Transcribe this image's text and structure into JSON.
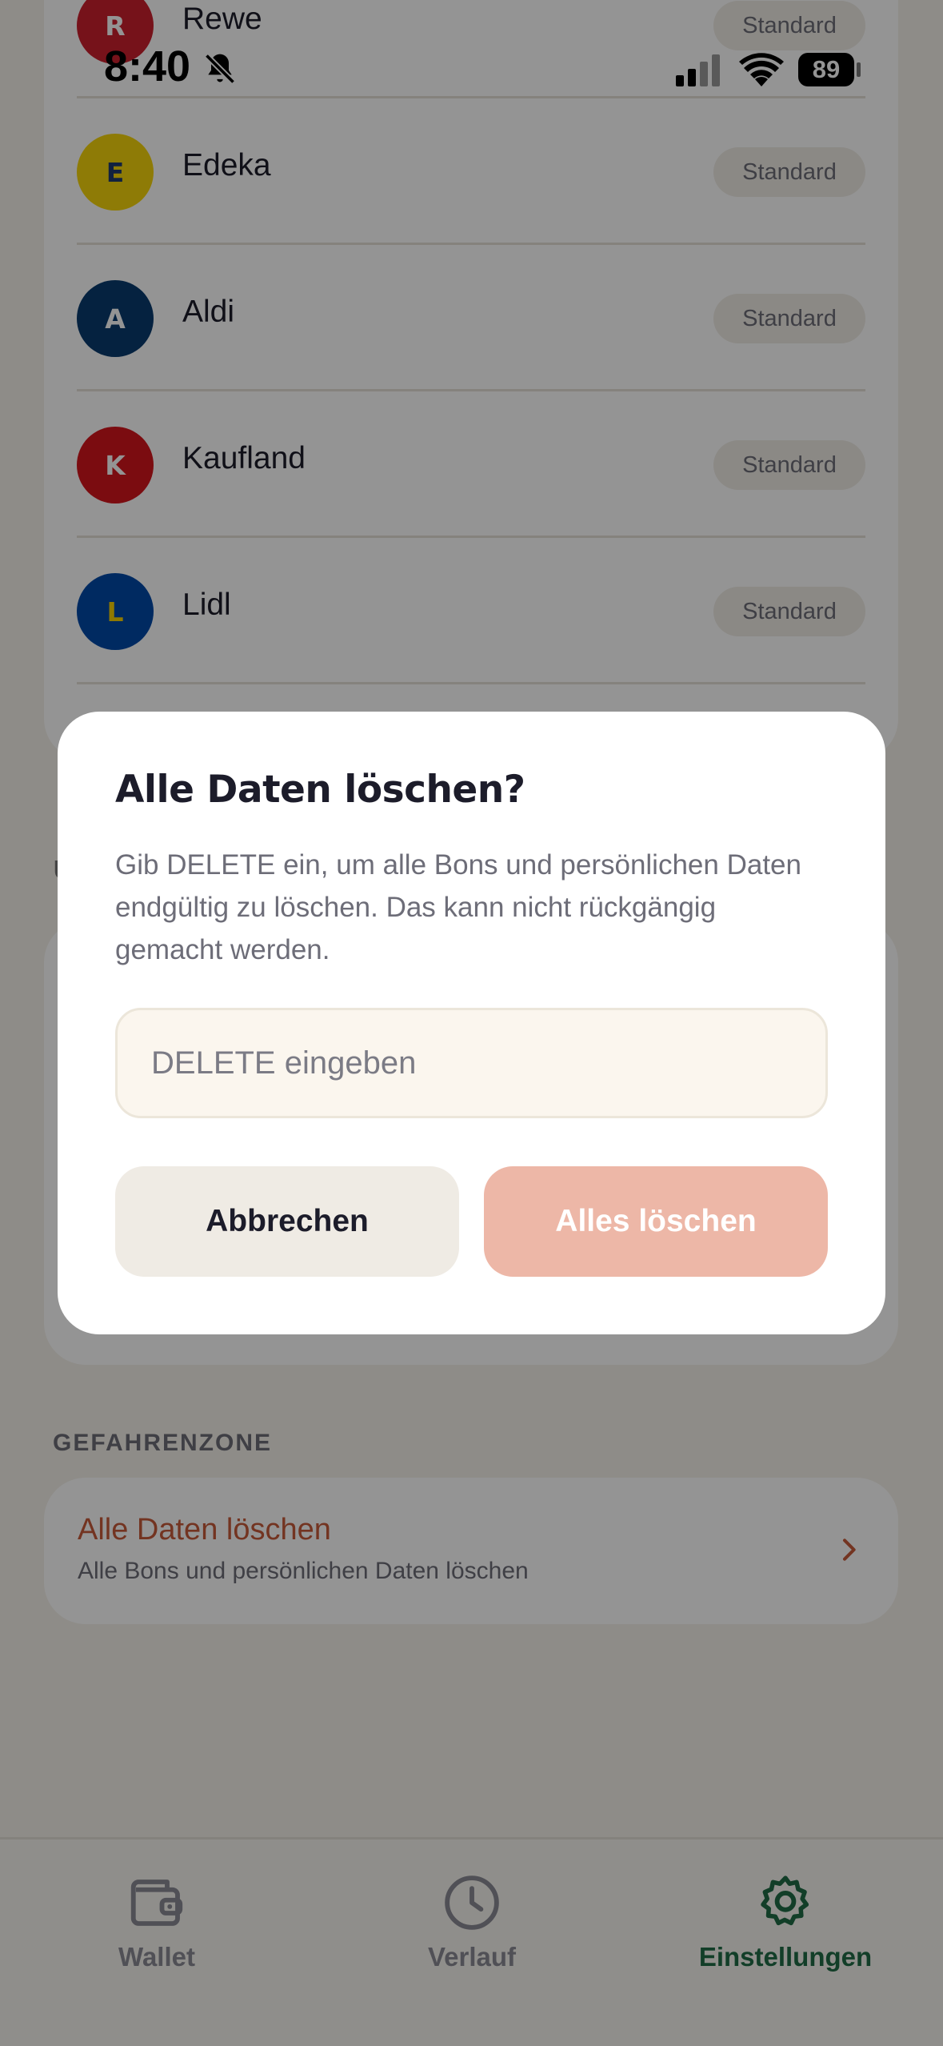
{
  "status_bar": {
    "time": "8:40",
    "battery": "89"
  },
  "stores": [
    {
      "name": "Rewe",
      "initial": "R",
      "badge": "Standard",
      "color": "#cc1f2e",
      "initial_color": "#ffffff"
    },
    {
      "name": "Edeka",
      "initial": "E",
      "badge": "Standard",
      "color": "#f5d40c",
      "initial_color": "#1e3a6e"
    },
    {
      "name": "Aldi",
      "initial": "A",
      "badge": "Standard",
      "color": "#0a3b6e",
      "initial_color": "#ffffff"
    },
    {
      "name": "Kaufland",
      "initial": "K",
      "badge": "Standard",
      "color": "#d4151d",
      "initial_color": "#ffffff"
    },
    {
      "name": "Lidl",
      "initial": "L",
      "badge": "Standard",
      "color": "#0049a8",
      "initial_color": "#f7d000"
    }
  ],
  "danger_zone": {
    "label": "GEFAHRENZONE",
    "title": "Alle Daten löschen",
    "subtitle": "Alle Bons und persönlichen Daten löschen"
  },
  "dialog": {
    "title": "Alle Daten löschen?",
    "body": "Gib DELETE ein, um alle Bons und persönlichen Daten endgültig zu löschen. Das kann nicht rückgängig gemacht werden.",
    "input_value": "",
    "input_placeholder": "DELETE eingeben",
    "cancel_label": "Abbrechen",
    "confirm_label": "Alles löschen"
  },
  "tabs": [
    {
      "label": "Wallet",
      "icon": "wallet-icon",
      "active": false
    },
    {
      "label": "Verlauf",
      "icon": "clock-icon",
      "active": false
    },
    {
      "label": "Einstellungen",
      "icon": "gear-icon",
      "active": true
    }
  ],
  "colors": {
    "accent": "#1f6b46",
    "danger": "#c65a3a",
    "danger_button_disabled": "#edb7a7"
  }
}
